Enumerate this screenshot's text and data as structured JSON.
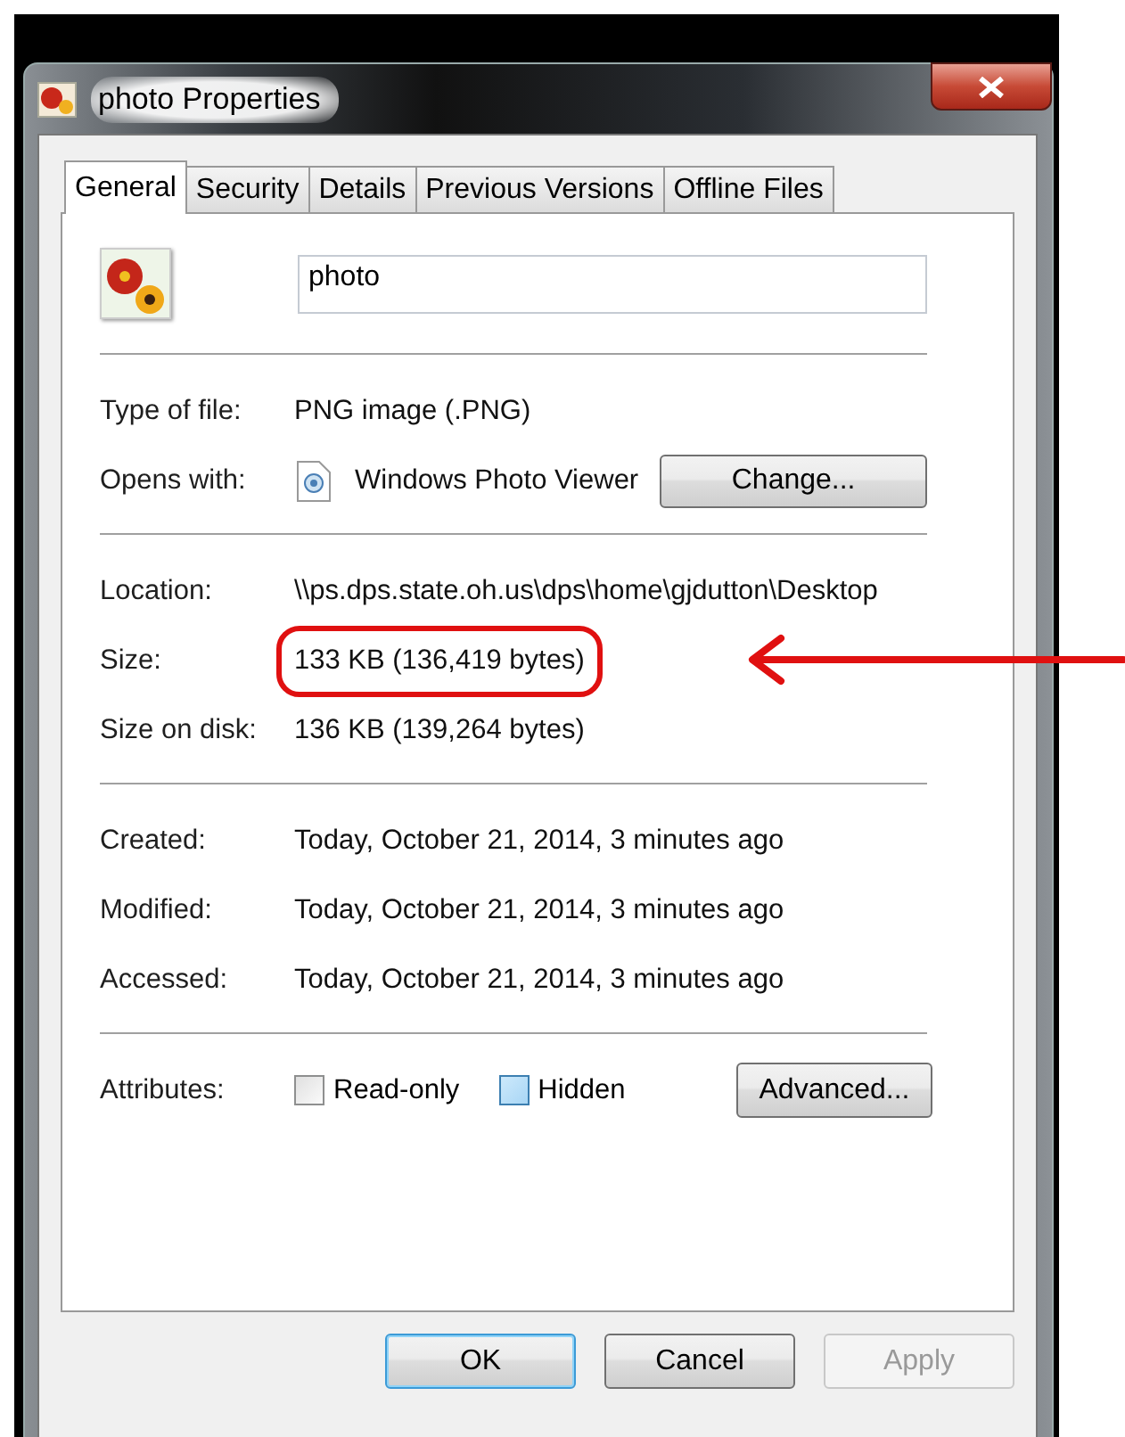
{
  "window": {
    "title": "photo Properties"
  },
  "tabs": [
    {
      "label": "General",
      "selected": true
    },
    {
      "label": "Security",
      "selected": false
    },
    {
      "label": "Details",
      "selected": false
    },
    {
      "label": "Previous Versions",
      "selected": false
    },
    {
      "label": "Offline Files",
      "selected": false
    }
  ],
  "file_name": {
    "value": "photo"
  },
  "sections": [
    [
      {
        "kind": "text",
        "label": "Type of file:",
        "value": "PNG image (.PNG)",
        "highlighted": false
      },
      {
        "kind": "app",
        "label": "Opens with:",
        "value": "Windows Photo Viewer",
        "button": "Change...",
        "highlighted": false
      }
    ],
    [
      {
        "kind": "text",
        "label": "Location:",
        "value": "\\\\ps.dps.state.oh.us\\dps\\home\\gjdutton\\Desktop",
        "highlighted": false
      },
      {
        "kind": "text",
        "label": "Size:",
        "value": "133 KB (136,419 bytes)",
        "highlighted": true
      },
      {
        "kind": "text",
        "label": "Size on disk:",
        "value": "136 KB (139,264 bytes)",
        "highlighted": false
      }
    ],
    [
      {
        "kind": "text",
        "label": "Created:",
        "value": "Today, October 21, 2014, 3 minutes ago",
        "highlighted": false
      },
      {
        "kind": "text",
        "label": "Modified:",
        "value": "Today, October 21, 2014, 3 minutes ago",
        "highlighted": false
      },
      {
        "kind": "text",
        "label": "Accessed:",
        "value": "Today, October 21, 2014, 3 minutes ago",
        "highlighted": false
      }
    ],
    [
      {
        "kind": "attributes",
        "label": "Attributes:",
        "checkboxes": [
          {
            "label": "Read-only",
            "checked": false,
            "hovered": false
          },
          {
            "label": "Hidden",
            "checked": false,
            "hovered": true
          }
        ],
        "button": "Advanced...",
        "highlighted": false
      }
    ]
  ],
  "buttons": [
    {
      "label": "OK",
      "default": true,
      "disabled": false
    },
    {
      "label": "Cancel",
      "default": false,
      "disabled": false
    },
    {
      "label": "Apply",
      "default": false,
      "disabled": true
    }
  ]
}
